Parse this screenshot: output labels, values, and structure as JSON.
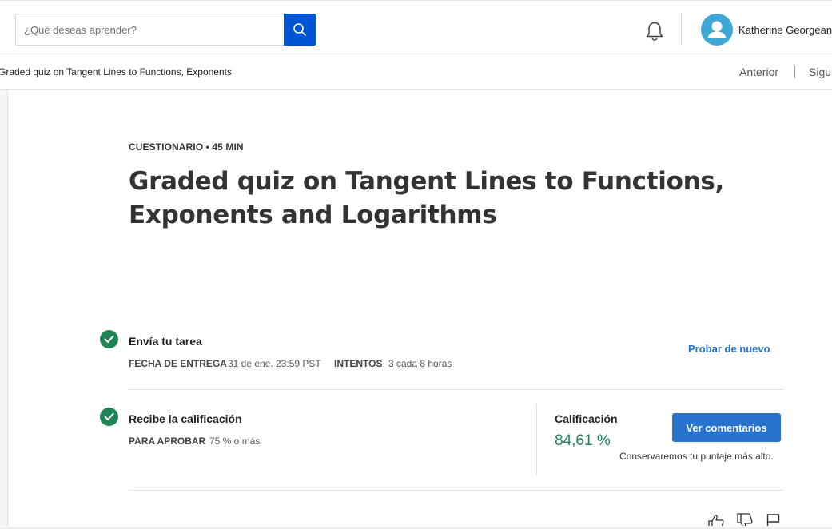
{
  "header": {
    "search_placeholder": "¿Qué deseas aprender?",
    "user_name": "Katherine Georgeanas",
    "search_button_color": "#0056d2",
    "avatar_color": "#3fa7d6"
  },
  "breadcrumb": {
    "item_title": "Graded quiz on Tangent Lines to Functions, Exponents and Logarithms",
    "prev_label": "Anterior",
    "next_label": "Siguiente"
  },
  "quiz": {
    "eyebrow": "CUESTIONARIO • 45 MIN",
    "title": "Graded quiz on Tangent Lines to Functions, Exponents and Logarithms"
  },
  "submit_step": {
    "title": "Envía tu tarea",
    "due_label": "FECHA DE ENTREGA",
    "due_value": "31 de ene. 23:59 PST",
    "attempts_label": "INTENTOS",
    "attempts_value": "3 cada 8 horas",
    "retry_label": "Probar de nuevo",
    "status_icon": "check-circle",
    "status_color": "#1f8354"
  },
  "grade_step": {
    "title": "Recibe la calificación",
    "pass_label": "PARA APROBAR",
    "pass_value": "75 % o más",
    "grade_label": "Calificación",
    "grade_value": "84,61 %",
    "feedback_button": "Ver comentarios",
    "keep_note": "Conservaremos tu puntaje más alto.",
    "status_icon": "check-circle",
    "grade_color": "#1f8354",
    "button_color": "#2a73cc"
  },
  "feedback_icons": [
    "thumbs-up",
    "thumbs-down",
    "flag"
  ]
}
